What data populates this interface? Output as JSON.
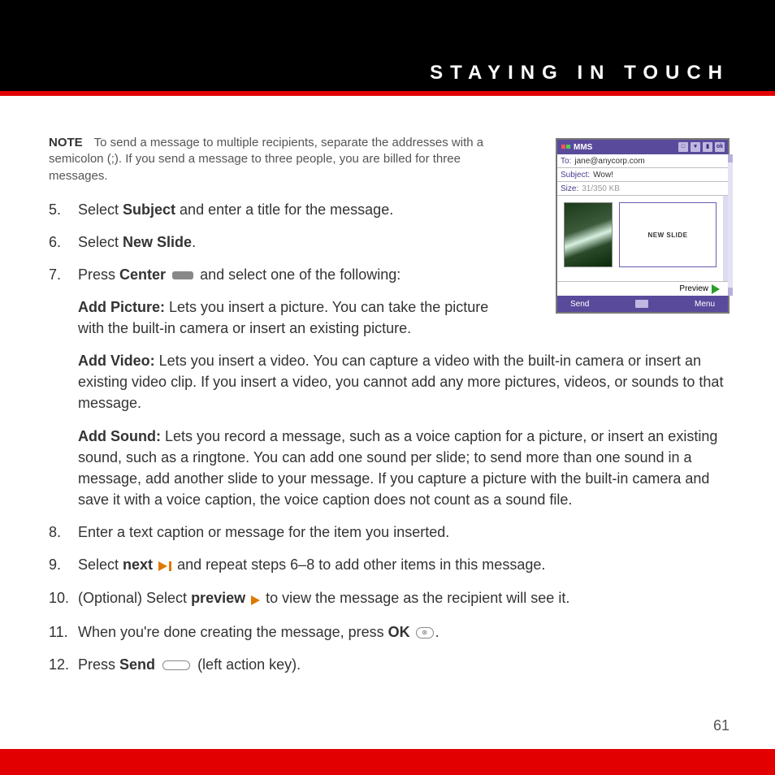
{
  "header": {
    "title": "STAYING IN TOUCH"
  },
  "note": {
    "label": "NOTE",
    "text": "To send a message to multiple recipients, separate the addresses with a semicolon (;). If you send a message to three people, you are billed for three messages."
  },
  "steps": {
    "s5": {
      "num": "5.",
      "pre": "Select ",
      "bold": "Subject",
      "post": " and enter a title for the message."
    },
    "s6": {
      "num": "6.",
      "pre": "Select ",
      "bold": "New Slide",
      "post": "."
    },
    "s7": {
      "num": "7.",
      "pre": "Press ",
      "bold": "Center",
      "post": " and select one of the following:"
    },
    "s8": {
      "num": "8.",
      "text": "Enter a text caption or message for the item you inserted."
    },
    "s9": {
      "num": "9.",
      "pre": "Select ",
      "bold": "next",
      "post": " and repeat steps 6–8 to add other items in this message."
    },
    "s10": {
      "num": "10.",
      "pre": "(Optional) Select ",
      "bold": "preview",
      "post": " to view the message as the recipient will see it."
    },
    "s11": {
      "num": "11.",
      "pre": "When you're done creating the message, press ",
      "bold": "OK",
      "post": "."
    },
    "s12": {
      "num": "12.",
      "pre": "Press ",
      "bold": "Send",
      "post": " (left action key)."
    }
  },
  "subs": {
    "add_picture": {
      "label": "Add Picture:",
      "text": " Lets you insert a picture. You can take the picture with the built-in camera or insert an existing picture."
    },
    "add_video": {
      "label": "Add Video:",
      "text": " Lets you insert a video. You can capture a video with the built-in camera or insert an existing video clip. If you insert a video, you cannot add any more pictures, videos, or sounds to that message."
    },
    "add_sound": {
      "label": "Add Sound:",
      "text": " Lets you record a message, such as a voice caption for a picture, or insert an existing sound, such as a ringtone. You can add one sound per slide; to send more than one sound in a message, add another slide to your message. If you capture a picture with the built-in camera and save it with a voice caption, the voice caption does not count as a sound file."
    }
  },
  "page_number": "61",
  "screenshot": {
    "app": "MMS",
    "ok": "ok",
    "to_label": "To:",
    "to_value": "jane@anycorp.com",
    "subject_label": "Subject:",
    "subject_value": "Wow!",
    "size_label": "Size:",
    "size_value": "31/350 KB",
    "new_slide": "NEW SLIDE",
    "preview": "Preview",
    "send": "Send",
    "menu": "Menu"
  }
}
